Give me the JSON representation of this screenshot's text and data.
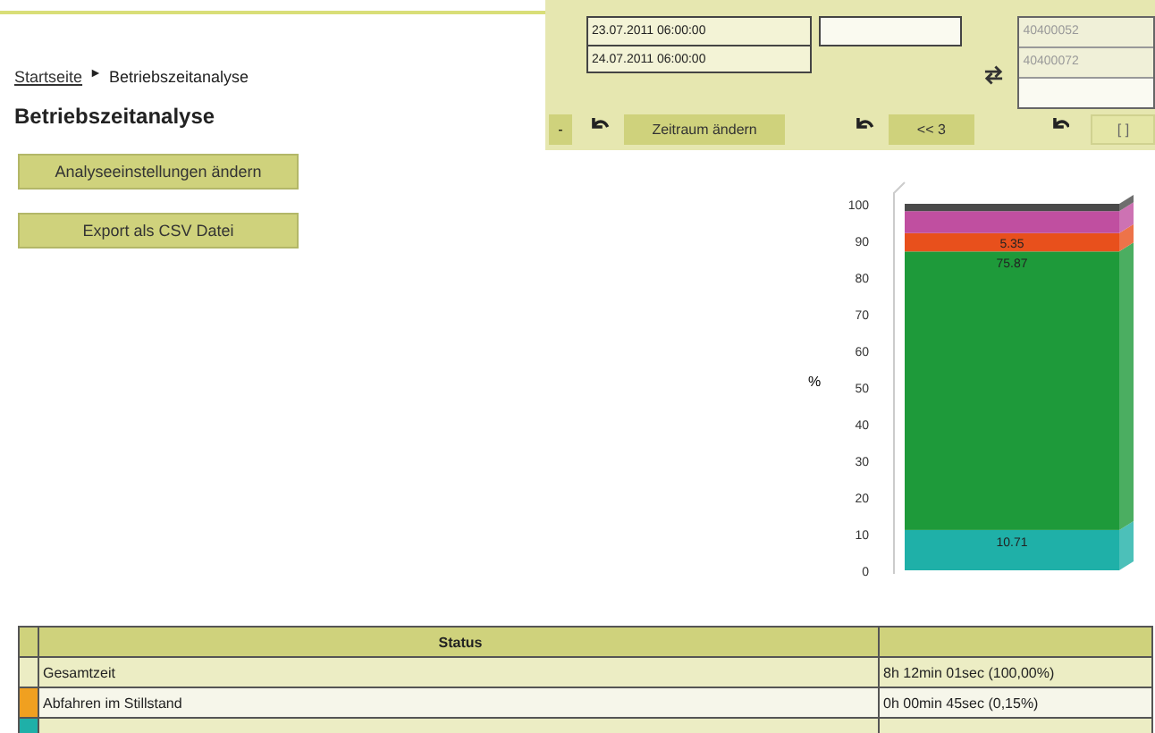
{
  "breadcrumb": {
    "link": "Startseite",
    "separator": "►",
    "current": "Betriebszeitanalyse"
  },
  "title": "Betriebszeitanalyse",
  "actions": [
    "Analyseeinstellungen ändern",
    "Export als CSV Datei"
  ],
  "filter": {
    "collapse": "-",
    "date_from": "23.07.2011 06:00:00",
    "date_to": "24.07.2011 06:00:00",
    "period_button": "Zeitraum ändern",
    "step_button": "<< 3",
    "machines": [
      "40400052",
      "40400072"
    ],
    "last_button": "[ ]"
  },
  "chart_data": {
    "type": "bar",
    "stacked": true,
    "ylabel": "%",
    "ylim": [
      0,
      100
    ],
    "yticks": [
      0,
      10,
      20,
      30,
      40,
      50,
      60,
      70,
      80,
      90,
      100
    ],
    "series": [
      {
        "color": "#1fb0a8",
        "values": [
          11
        ]
      },
      {
        "color": "#1e9a3a",
        "values": [
          76
        ]
      },
      {
        "color": "#e8501c",
        "values": [
          5
        ]
      },
      {
        "color": "#c04fa0",
        "values": [
          6
        ]
      },
      {
        "color": "#4a4a4a",
        "values": [
          2
        ]
      }
    ],
    "annotations": [
      "10.71",
      "75.87",
      "5.35"
    ]
  },
  "table": {
    "columns": [
      "Status"
    ],
    "rows": [
      {
        "status": "Gesamtzeit",
        "duration": "8h 12min 01sec (100,00%)"
      },
      {
        "status": "Abfahren im Stillstand",
        "duration": "0h 00min 45sec (0,15%)",
        "color": "#f0a020"
      },
      {
        "color": "#1fb0a8"
      }
    ]
  }
}
